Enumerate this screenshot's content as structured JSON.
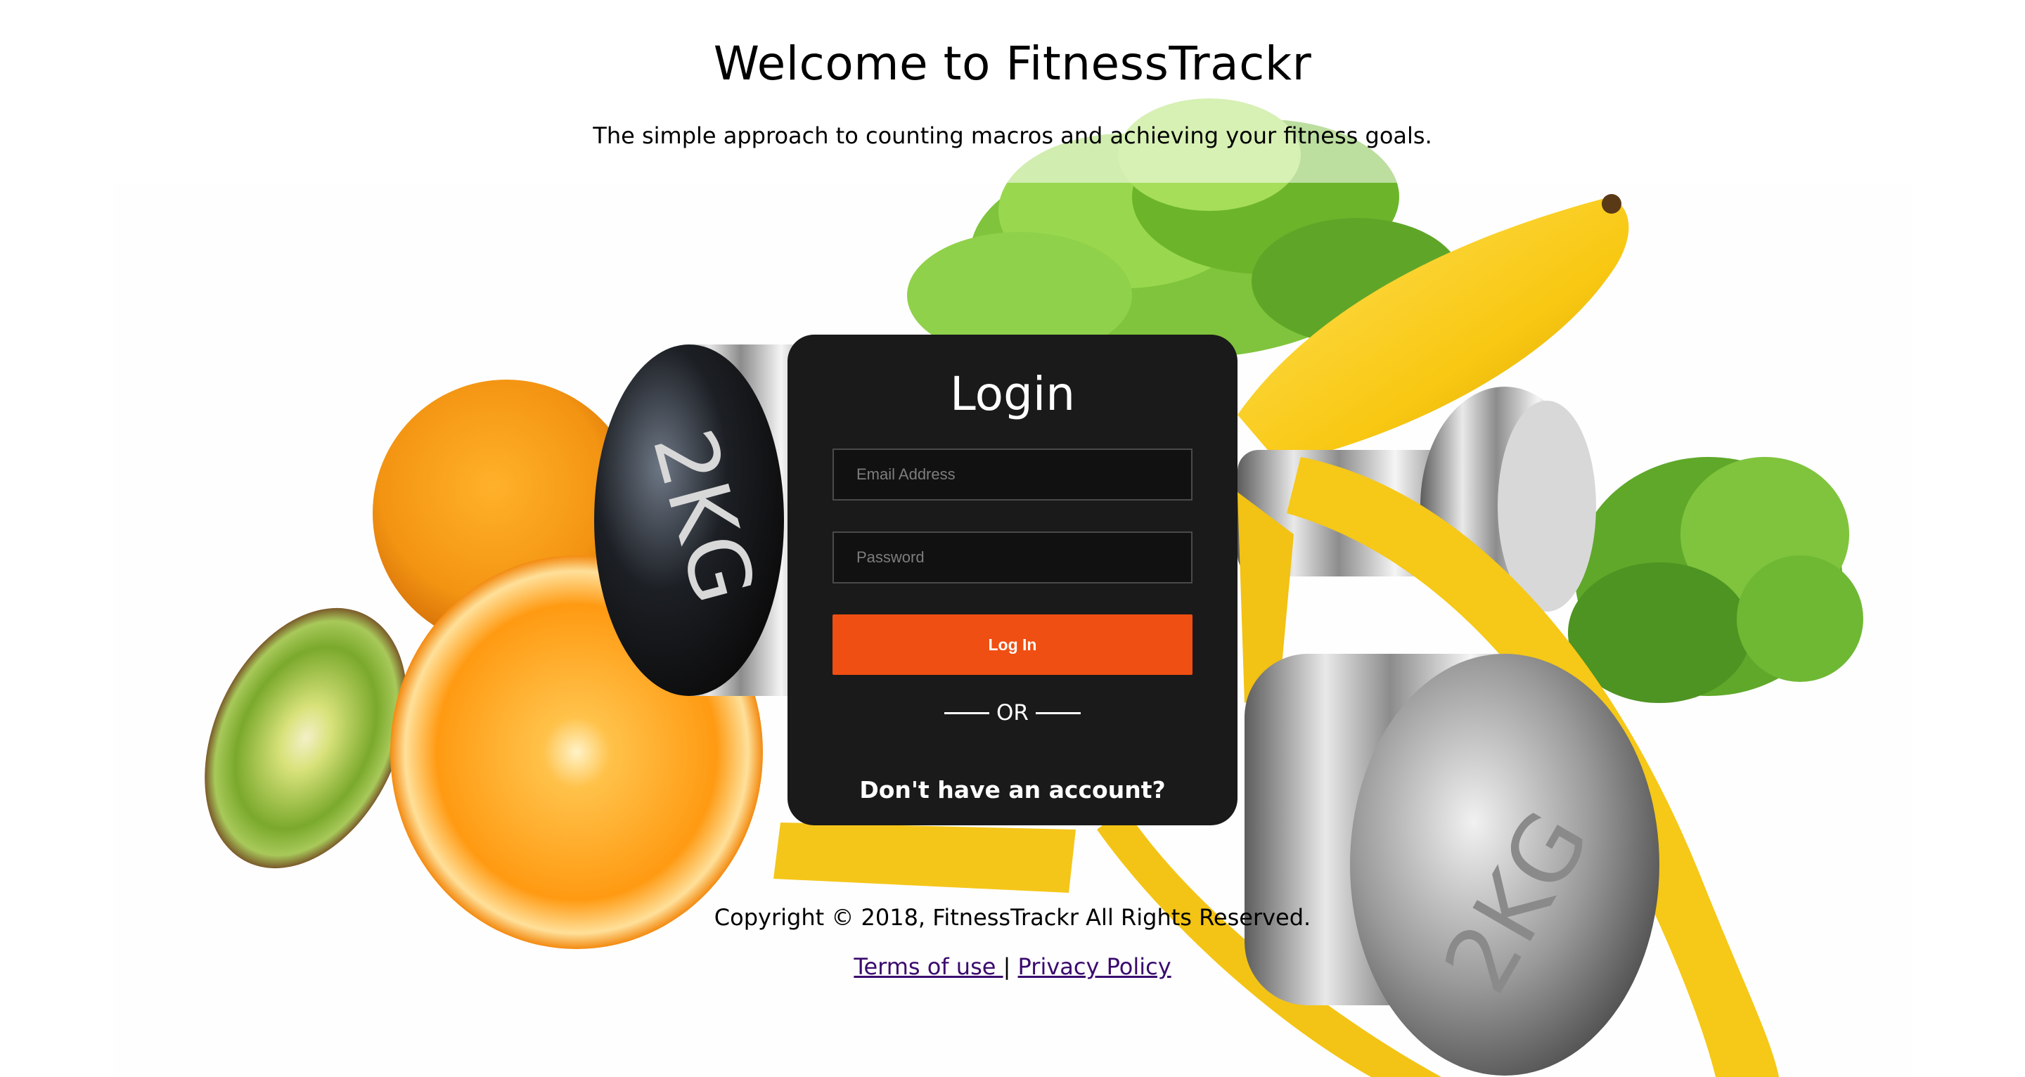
{
  "header": {
    "title": "Welcome to FitnessTrackr",
    "subtitle": "The simple approach to counting macros and achieving your fitness goals."
  },
  "login": {
    "title": "Login",
    "email_placeholder": "Email Address",
    "password_placeholder": "Password",
    "submit_label": "Log In",
    "divider_label": "OR",
    "signup_label": "Don't have an account?"
  },
  "background": {
    "dumbbell_text_left": "2KG",
    "dumbbell_text_right": "2KG"
  },
  "footer": {
    "copyright": "Copyright © 2018, FitnessTrackr All Rights Reserved.",
    "terms_label": "Terms of use ",
    "separator": "|",
    "privacy_label": "Privacy Policy"
  },
  "colors": {
    "card_bg": "#1a1a1a",
    "button_bg": "#ef4f12",
    "link": "#3a0a6e"
  }
}
